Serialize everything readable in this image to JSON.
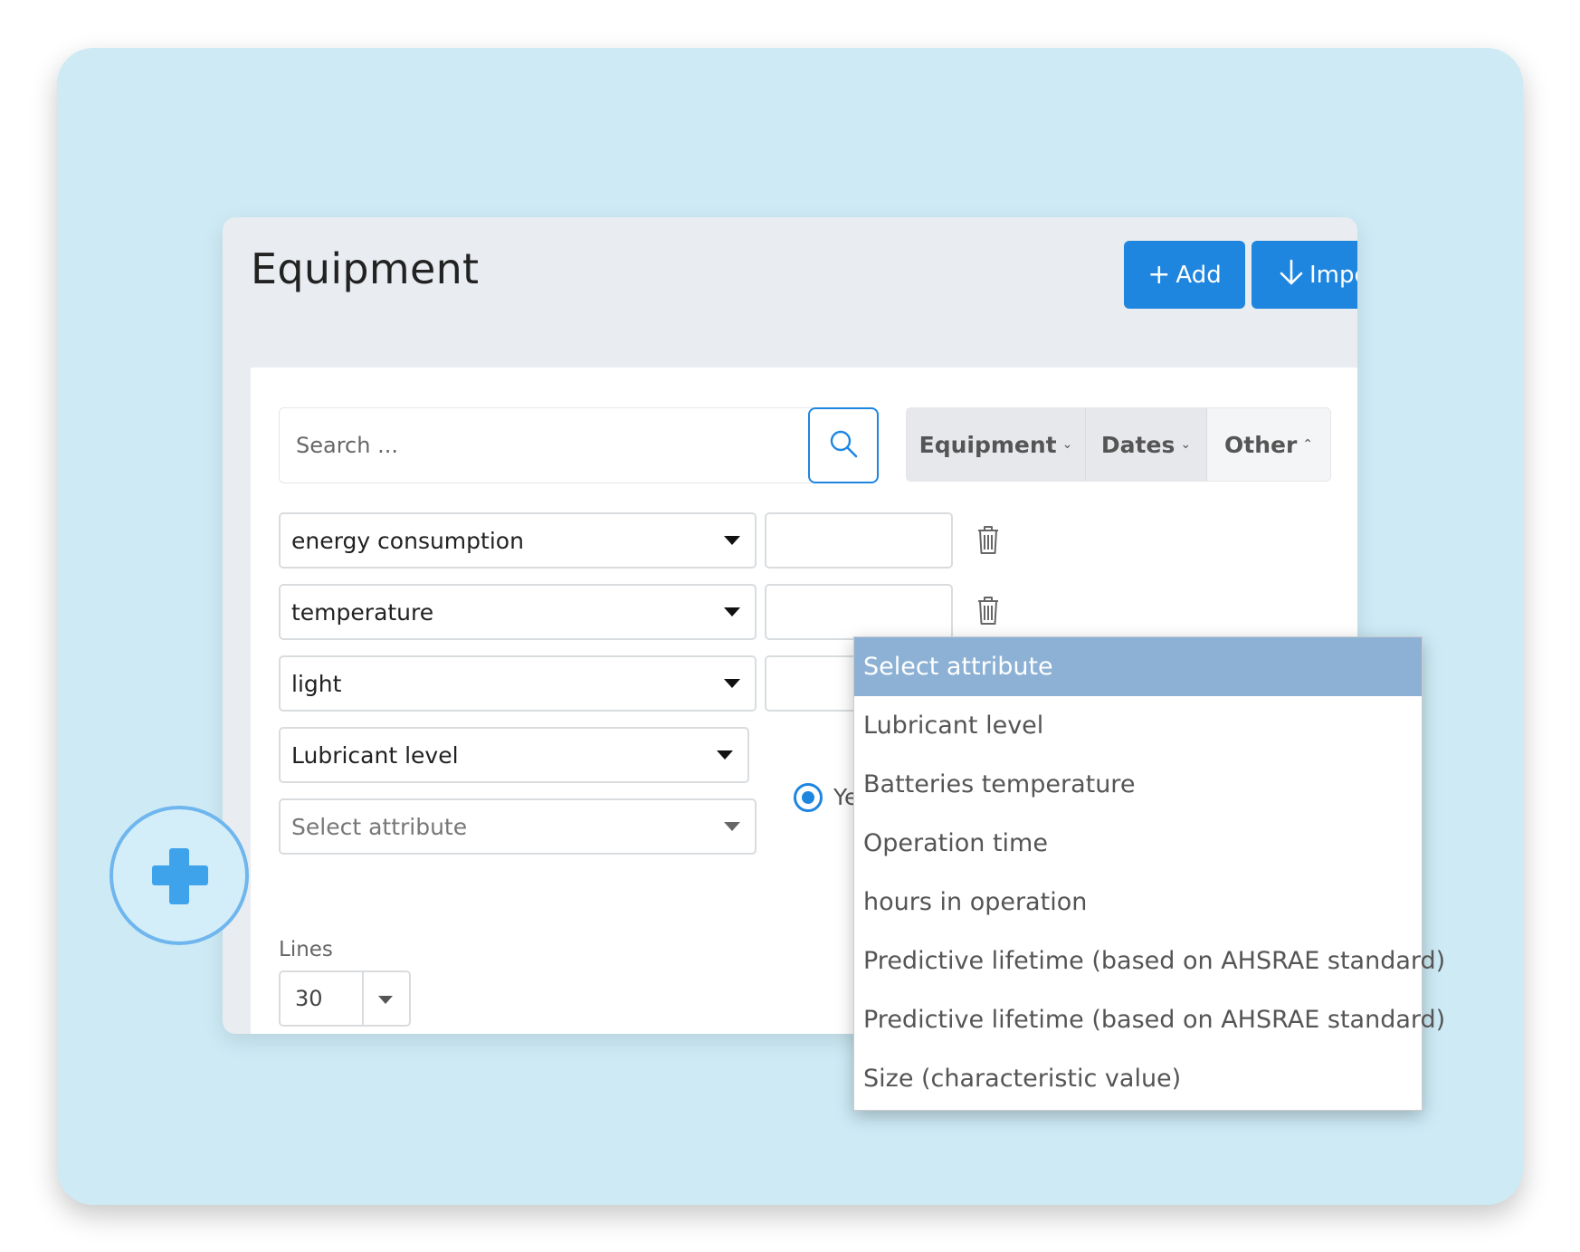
{
  "header": {
    "title": "Equipment",
    "add_label": "Add",
    "import_label": "Impo"
  },
  "search": {
    "placeholder": "Search ..."
  },
  "filters": [
    {
      "label": "Equipment",
      "chevron": "⌄"
    },
    {
      "label": "Dates",
      "chevron": "⌄"
    },
    {
      "label": "Other",
      "chevron": "⌃"
    }
  ],
  "attributes": [
    {
      "label": "energy consumption"
    },
    {
      "label": "temperature"
    },
    {
      "label": "light"
    },
    {
      "label": "Lubricant level"
    },
    {
      "label": "Select attribute"
    }
  ],
  "radio": {
    "label": "Ye"
  },
  "lines": {
    "label": "Lines",
    "value": "30"
  },
  "dropdown": {
    "options": [
      "Select attribute",
      "Lubricant level",
      "Batteries temperature",
      "Operation time",
      "hours in operation",
      "Predictive lifetime (based on AHSRAE standard)",
      "Predictive lifetime (based on AHSRAE standard)",
      "Size (characteristic value)"
    ]
  },
  "colors": {
    "accent": "#1f86e0",
    "dropdown_selected": "#8cb1d5",
    "backdrop": "#cdeaf5",
    "plus": "#3fa3ec"
  }
}
